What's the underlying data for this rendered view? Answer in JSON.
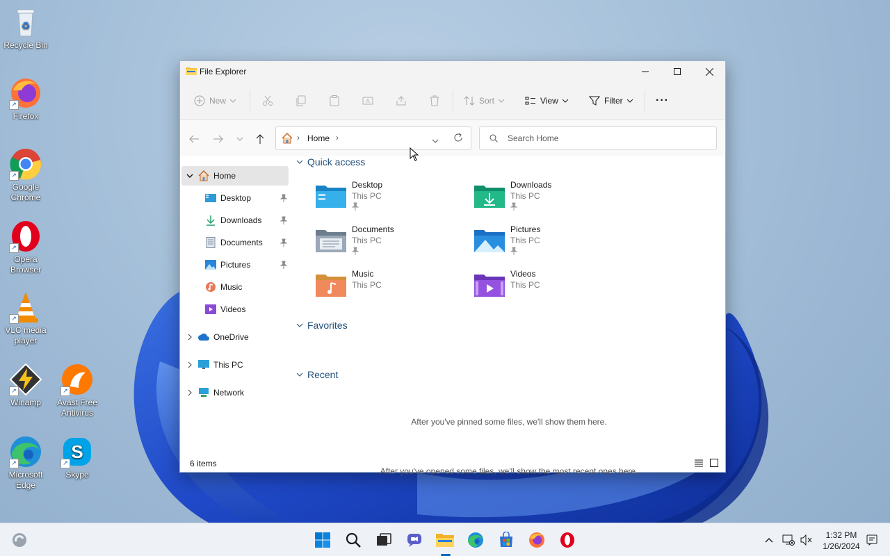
{
  "desktop": {
    "icons": [
      {
        "label": "Recycle Bin"
      },
      {
        "label": "Firefox"
      },
      {
        "label": "Google Chrome"
      },
      {
        "label": "Opera Browser"
      },
      {
        "label": "VLC media player"
      },
      {
        "label": "Winamp"
      },
      {
        "label": "Avast Free Antivirus"
      },
      {
        "label": "Microsoft Edge"
      },
      {
        "label": "Skype"
      }
    ]
  },
  "window": {
    "title": "File Explorer",
    "icon": "folder-icon",
    "controls": [
      "minimize-icon",
      "maximize-icon",
      "close-icon"
    ]
  },
  "commandbar": {
    "new_label": "New",
    "sort_label": "Sort",
    "view_label": "View",
    "filter_label": "Filter",
    "more_label": "···"
  },
  "address": {
    "crumbs": [
      "Home"
    ],
    "search_placeholder": "Search Home"
  },
  "sidebar": {
    "items": [
      {
        "label": "Home",
        "icon": "home-icon",
        "selected": true
      },
      {
        "label": "Desktop",
        "icon": "desktop-icon",
        "pinned": true
      },
      {
        "label": "Downloads",
        "icon": "download-icon",
        "pinned": true
      },
      {
        "label": "Documents",
        "icon": "document-icon",
        "pinned": true
      },
      {
        "label": "Pictures",
        "icon": "picture-icon",
        "pinned": true
      },
      {
        "label": "Music",
        "icon": "music-icon"
      },
      {
        "label": "Videos",
        "icon": "video-icon"
      },
      {
        "label": "OneDrive",
        "icon": "cloud-icon"
      },
      {
        "label": "This PC",
        "icon": "monitor-icon"
      },
      {
        "label": "Network",
        "icon": "network-icon"
      }
    ]
  },
  "content": {
    "quick_access": {
      "heading": "Quick access",
      "items": [
        {
          "name": "Desktop",
          "location": "This PC",
          "pinned": true
        },
        {
          "name": "Downloads",
          "location": "This PC",
          "pinned": true
        },
        {
          "name": "Documents",
          "location": "This PC",
          "pinned": true
        },
        {
          "name": "Pictures",
          "location": "This PC",
          "pinned": true
        },
        {
          "name": "Music",
          "location": "This PC",
          "pinned": false
        },
        {
          "name": "Videos",
          "location": "This PC",
          "pinned": false
        }
      ]
    },
    "favorites": {
      "heading": "Favorites",
      "empty_text": "After you've pinned some files, we'll show them here."
    },
    "recent": {
      "heading": "Recent",
      "empty_text": "After you've opened some files, we'll show the most recent ones here."
    }
  },
  "status": {
    "item_count": "6 items"
  },
  "taskbar": {
    "time": "1:32 PM",
    "date": "1/26/2024",
    "apps": [
      "start-icon",
      "search-icon",
      "task-view-icon",
      "chat-icon",
      "file-explorer-icon",
      "edge-icon",
      "store-icon",
      "firefox-icon",
      "opera-icon"
    ]
  },
  "colors": {
    "accent": "#0067c0",
    "heading": "#1f4e79"
  }
}
